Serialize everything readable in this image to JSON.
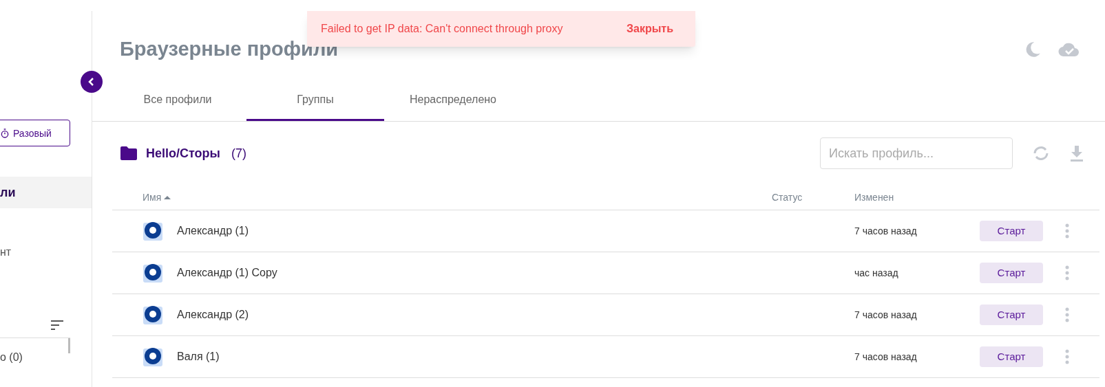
{
  "toast": {
    "message": "Failed to get IP data: Can't connect through proxy",
    "action": "Закрыть"
  },
  "sidebar": {
    "mode_button": "Разовый",
    "items": [
      {
        "label": "ли",
        "selected": true
      },
      {
        "label": "нт",
        "selected": false
      }
    ],
    "groups": [
      {
        "label": "о (0)"
      }
    ]
  },
  "page": {
    "title": "Браузерные профили"
  },
  "tabs": [
    {
      "label": "Все профили",
      "selected": false
    },
    {
      "label": "Группы",
      "selected": true
    },
    {
      "label": "Нераспределено",
      "selected": false
    }
  ],
  "group": {
    "name": "Hello/Сторы",
    "count": "(7)"
  },
  "search": {
    "placeholder": "Искать профиль..."
  },
  "table": {
    "columns": [
      "Имя",
      "Статус",
      "Изменен"
    ],
    "rows": [
      {
        "name": "Александр (1)",
        "status": "",
        "modified": "7 часов назад",
        "action": "Старт"
      },
      {
        "name": "Александр (1) Copy",
        "status": "",
        "modified": "час назад",
        "action": "Старт"
      },
      {
        "name": "Александр (2)",
        "status": "",
        "modified": "7 часов назад",
        "action": "Старт"
      },
      {
        "name": "Валя (1)",
        "status": "",
        "modified": "7 часов назад",
        "action": "Старт"
      }
    ]
  }
}
